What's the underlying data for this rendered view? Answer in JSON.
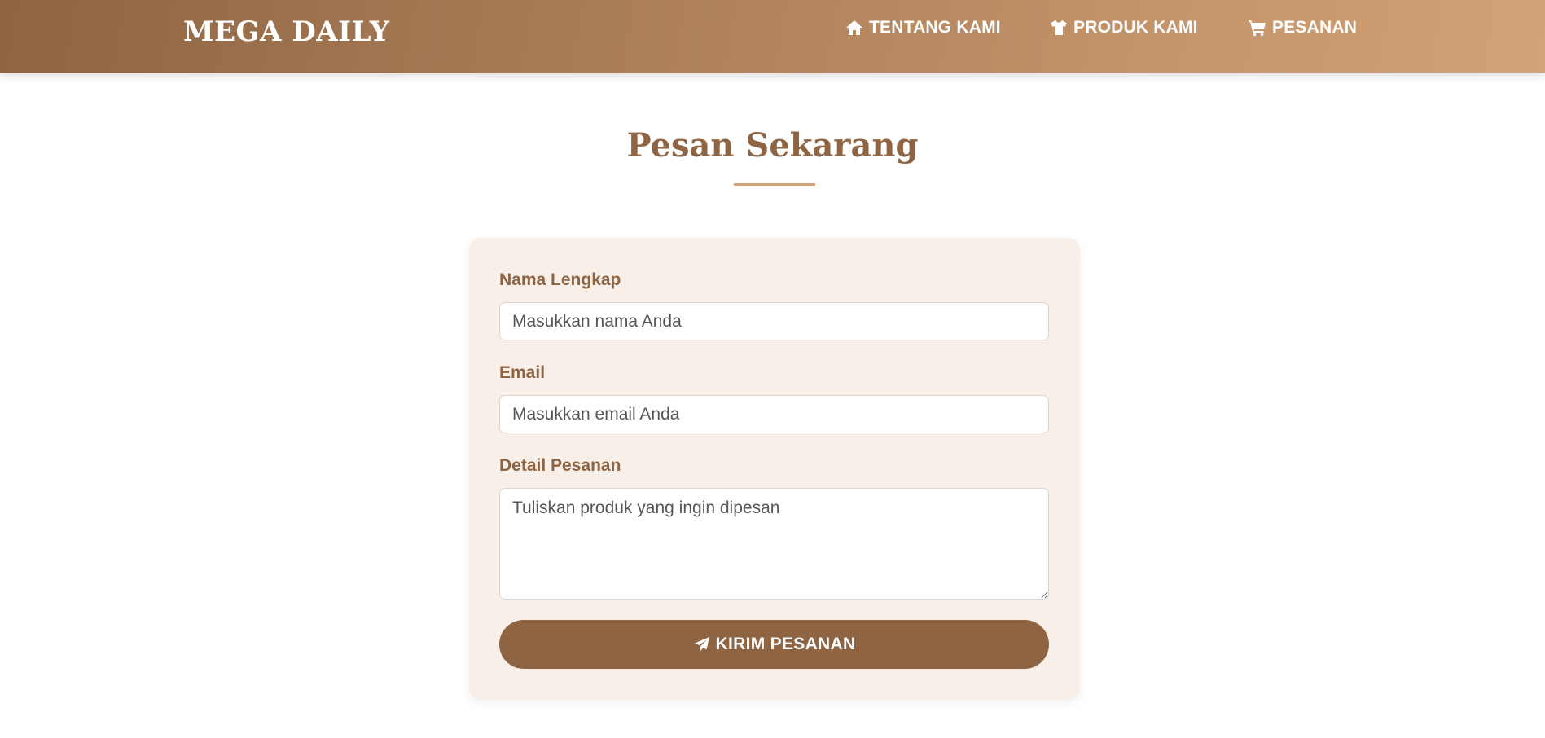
{
  "brand": {
    "name": "MEGA DAILY"
  },
  "nav": {
    "items": [
      {
        "icon": "home-icon",
        "label": "TENTANG KAMI"
      },
      {
        "icon": "shirt-icon",
        "label": "PRODUK KAMI"
      },
      {
        "icon": "cart-icon",
        "label": "PESANAN"
      }
    ]
  },
  "page": {
    "title": "Pesan Sekarang"
  },
  "form": {
    "name": {
      "label": "Nama Lengkap",
      "placeholder": "Masukkan nama Anda",
      "value": ""
    },
    "email": {
      "label": "Email",
      "placeholder": "Masukkan email Anda",
      "value": ""
    },
    "details": {
      "label": "Detail Pesanan",
      "placeholder": "Tuliskan produk yang ingin dipesan",
      "value": ""
    },
    "submit": {
      "icon": "paper-plane-icon",
      "label": "KIRIM PESANAN"
    }
  },
  "colors": {
    "primary": "#8e6443",
    "accent": "#d3a276",
    "card_background": "#f7efe8",
    "text_on_primary": "#ffffff"
  }
}
